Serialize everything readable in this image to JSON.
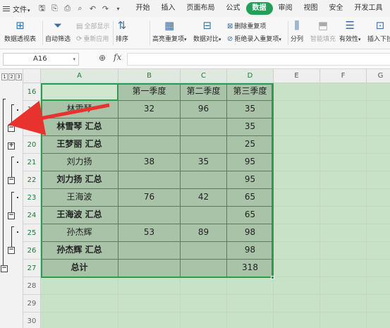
{
  "menu": {
    "file_label": "文件",
    "tabs": [
      "开始",
      "插入",
      "页面布局",
      "公式",
      "数据",
      "审阅",
      "视图",
      "安全",
      "开发工具"
    ],
    "active_tab": "数据"
  },
  "ribbon": {
    "pivot": "数据透视表",
    "autofilter": "自动筛选",
    "show_all": "全部显示",
    "reapply": "重新应用",
    "sort": "排序",
    "highlight_dup": "高亮重复项",
    "compare": "数据对比",
    "remove_dup": "删除重复项",
    "reject_dup": "拒绝录入重复项",
    "split": "分列",
    "smart_fill": "智能填充",
    "validity": "有效性",
    "insert_dropdown": "插入下拉"
  },
  "formula_bar": {
    "name_box": "A16",
    "fx": "fx",
    "formula": ""
  },
  "outline_levels": [
    "1",
    "2",
    "3"
  ],
  "columns": [
    "A",
    "B",
    "C",
    "D",
    "E",
    "F",
    "G"
  ],
  "rows": [
    {
      "num": "16",
      "a": "",
      "b": "第一季度",
      "c": "第二季度",
      "d": "第三季度"
    },
    {
      "num": "17",
      "a": "林雪琴",
      "b": "32",
      "c": "96",
      "d": "35"
    },
    {
      "num": "18",
      "a": "林雪琴 汇总",
      "b": "",
      "c": "",
      "d": "35"
    },
    {
      "num": "20",
      "a": "王梦丽 汇总",
      "b": "",
      "c": "",
      "d": "25"
    },
    {
      "num": "21",
      "a": "刘力扬",
      "b": "38",
      "c": "35",
      "d": "95"
    },
    {
      "num": "22",
      "a": "刘力扬 汇总",
      "b": "",
      "c": "",
      "d": "95"
    },
    {
      "num": "23",
      "a": "王海波",
      "b": "76",
      "c": "42",
      "d": "65"
    },
    {
      "num": "24",
      "a": "王海波 汇总",
      "b": "",
      "c": "",
      "d": "65"
    },
    {
      "num": "25",
      "a": "孙杰辉",
      "b": "53",
      "c": "89",
      "d": "98"
    },
    {
      "num": "26",
      "a": "孙杰辉 汇总",
      "b": "",
      "c": "",
      "d": "98"
    },
    {
      "num": "27",
      "a": "总计",
      "b": "",
      "c": "",
      "d": "318"
    },
    {
      "num": "28",
      "a": "",
      "b": "",
      "c": "",
      "d": ""
    },
    {
      "num": "29",
      "a": "",
      "b": "",
      "c": "",
      "d": ""
    },
    {
      "num": "30",
      "a": "",
      "b": "",
      "c": "",
      "d": ""
    }
  ],
  "colors": {
    "accent": "#22a05a",
    "table_fill": "#a9c3a9",
    "sheet_bg": "#c8e2c8",
    "arrow": "#e8322e"
  }
}
